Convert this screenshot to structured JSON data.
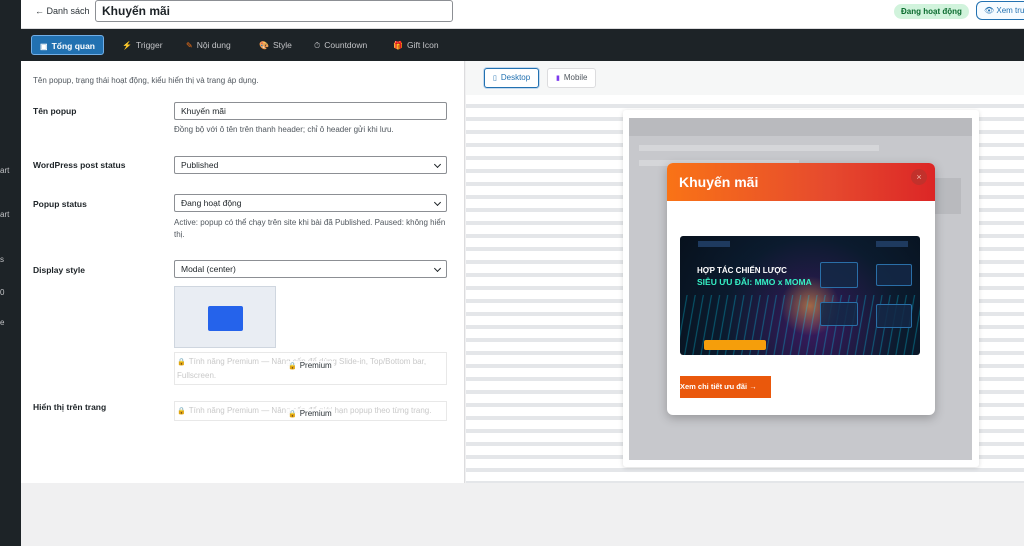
{
  "sidebar": {
    "fragments": [
      "art",
      "art",
      "s",
      "0",
      "e"
    ]
  },
  "header": {
    "back_label": "← Danh sách",
    "title_value": "Khuyến mãi",
    "status_badge": "Đang hoạt động",
    "preview_label": "👁 Xem trư"
  },
  "tabs": [
    {
      "icon": "▣",
      "label": "Tổng quan"
    },
    {
      "icon": "⚡",
      "label": "Trigger"
    },
    {
      "icon": "✎",
      "label": "Nội dung"
    },
    {
      "icon": "🎨",
      "label": "Style"
    },
    {
      "icon": "⏱",
      "label": "Countdown"
    },
    {
      "icon": "🎁",
      "label": "Gift Icon"
    }
  ],
  "overview": {
    "intro": "Tên popup, trạng thái hoạt động, kiểu hiển thị và trang áp dụng.",
    "popup_name": {
      "label": "Tên popup",
      "value": "Khuyến mãi",
      "help": "Đồng bộ với ô tên trên thanh header; chỉ ô header gửi khi lưu."
    },
    "post_status": {
      "label": "WordPress post status",
      "value": "Published"
    },
    "popup_status": {
      "label": "Popup status",
      "value": "Đang hoạt động",
      "help": "Active: popup có thể chạy trên site khi bài đã Published. Paused: không hiển thị."
    },
    "display_style": {
      "label": "Display style",
      "value": "Modal (center)",
      "locked_text": "Tính năng Premium — Nâng cấp để dùng Slide-in, Top/Bottom bar, Fullscreen.",
      "premium": "Premium"
    },
    "pages": {
      "label": "Hiển thị trên trang",
      "locked_text": "Tính năng Premium — Nâng cấp để giới hạn popup theo từng trang.",
      "premium": "Premium"
    }
  },
  "preview": {
    "tabs": [
      {
        "icon": "▯",
        "label": "Desktop"
      },
      {
        "icon": "▮",
        "label": "Mobile"
      }
    ],
    "popup_title": "Khuyến mãi",
    "close_glyph": "×",
    "banner_line1": "HỢP TÁC CHIẾN LƯỢC",
    "banner_line2": "SIÊU ƯU ĐÃI: MMO x MOMA",
    "cta_label": "Xem chi tiết ưu đãi →"
  },
  "colors": {
    "accent": "#2271b1",
    "admin_dark": "#1d2327",
    "popup_orange": "#ea580c",
    "status_green": "#d1f3dc"
  }
}
